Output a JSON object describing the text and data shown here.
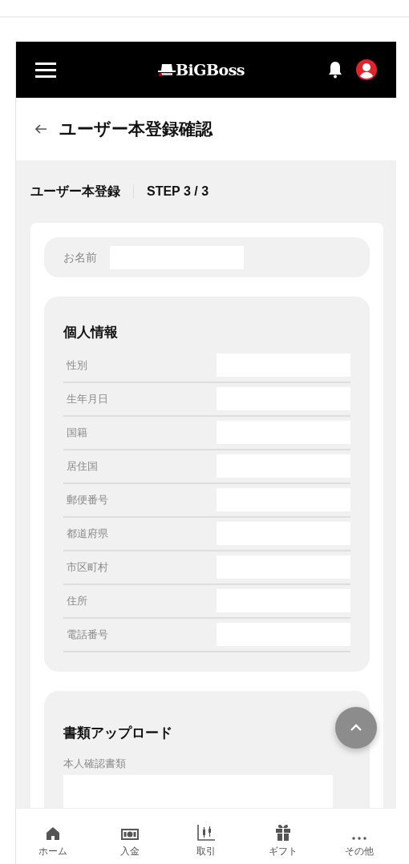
{
  "header": {
    "logo": "BiGBoss"
  },
  "page_title": "ユーザー本登録確認",
  "step": {
    "label": "ユーザー本登録",
    "progress": "STEP 3 / 3"
  },
  "name_field": {
    "label": "お名前"
  },
  "personal_info": {
    "title": "個人情報",
    "fields": [
      {
        "label": "性別"
      },
      {
        "label": "生年月日"
      },
      {
        "label": "国籍"
      },
      {
        "label": "居住国"
      },
      {
        "label": "郵便番号"
      },
      {
        "label": "都道府県"
      },
      {
        "label": "市区町村"
      },
      {
        "label": "住所"
      },
      {
        "label": "電話番号"
      }
    ]
  },
  "documents": {
    "title": "書類アップロード",
    "fields": [
      {
        "label": "本人確認書類"
      }
    ]
  },
  "bottom_nav": [
    {
      "kind": "home",
      "label": "ホーム"
    },
    {
      "kind": "deposit",
      "label": "入金"
    },
    {
      "kind": "trade",
      "label": "取引"
    },
    {
      "kind": "gift",
      "label": "ギフト"
    },
    {
      "kind": "more",
      "label": "その他"
    }
  ]
}
